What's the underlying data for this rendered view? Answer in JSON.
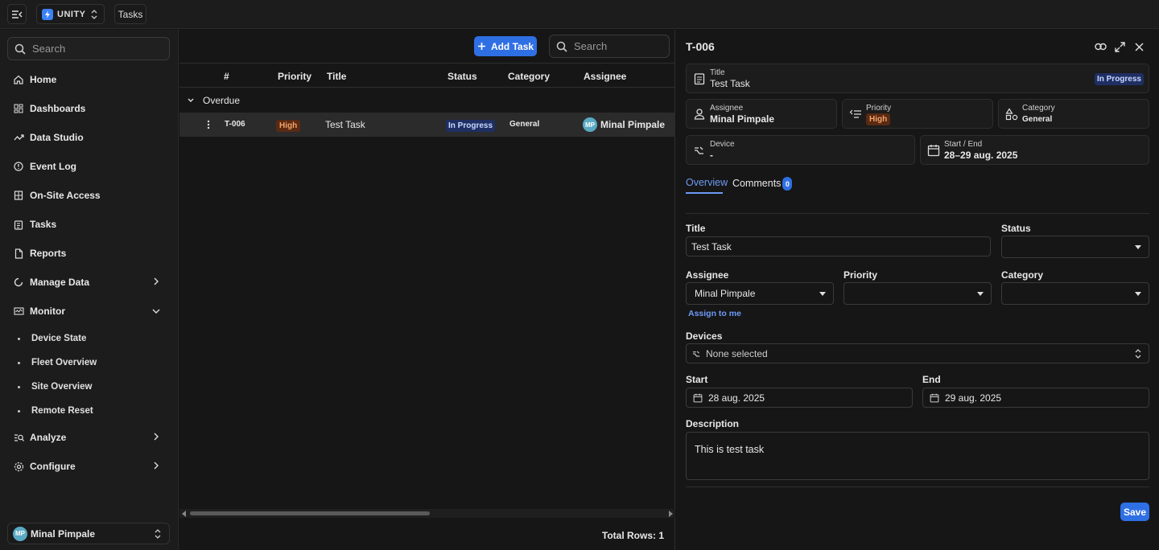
{
  "topbar": {
    "brand": "UNITY",
    "breadcrumb": "Tasks"
  },
  "sidebar": {
    "search_placeholder": "Search",
    "items": [
      {
        "label": "Home"
      },
      {
        "label": "Dashboards"
      },
      {
        "label": "Data Studio"
      },
      {
        "label": "Event Log"
      },
      {
        "label": "On-Site Access"
      },
      {
        "label": "Tasks"
      },
      {
        "label": "Reports"
      },
      {
        "label": "Manage Data"
      },
      {
        "label": "Monitor"
      },
      {
        "label": "Analyze"
      },
      {
        "label": "Configure"
      }
    ],
    "monitor_sub": [
      {
        "label": "Device State"
      },
      {
        "label": "Fleet Overview"
      },
      {
        "label": "Site Overview"
      },
      {
        "label": "Remote Reset"
      }
    ],
    "user": {
      "initials": "MP",
      "name": "Minal Pimpale"
    }
  },
  "main": {
    "add_task": "Add Task",
    "search_placeholder": "Search",
    "columns": [
      "#",
      "Priority",
      "Title",
      "Status",
      "Category",
      "Assignee"
    ],
    "group": "Overdue",
    "row": {
      "id": "T-006",
      "priority": "High",
      "title": "Test Task",
      "status": "In Progress",
      "category": "General",
      "assignee_initials": "MP",
      "assignee": "Minal Pimpale"
    },
    "total_rows": "Total Rows: 1"
  },
  "panel": {
    "task_id": "T-006",
    "title_card": {
      "label": "Title",
      "value": "Test Task",
      "status": "In Progress"
    },
    "assignee_card": {
      "label": "Assignee",
      "value": "Minal Pimpale"
    },
    "priority_card": {
      "label": "Priority",
      "value": "High"
    },
    "category_card": {
      "label": "Category",
      "value": "General"
    },
    "device_card": {
      "label": "Device",
      "value": "-"
    },
    "dates_card": {
      "label": "Start / End",
      "value": "28–29 aug. 2025"
    },
    "tabs": {
      "overview": "Overview",
      "comments": "Comments",
      "comments_count": "0"
    },
    "form": {
      "title_label": "Title",
      "title_value": "Test Task",
      "status_label": "Status",
      "status_value": "",
      "assignee_label": "Assignee",
      "assignee_value": "Minal Pimpale",
      "assign_to_me": "Assign to me",
      "priority_label": "Priority",
      "priority_value": "",
      "category_label": "Category",
      "category_value": "",
      "devices_label": "Devices",
      "devices_value": "None selected",
      "start_label": "Start",
      "start_value": "28 aug. 2025",
      "end_label": "End",
      "end_value": "29 aug. 2025",
      "description_label": "Description",
      "description_value": "This is test task",
      "save": "Save"
    }
  }
}
